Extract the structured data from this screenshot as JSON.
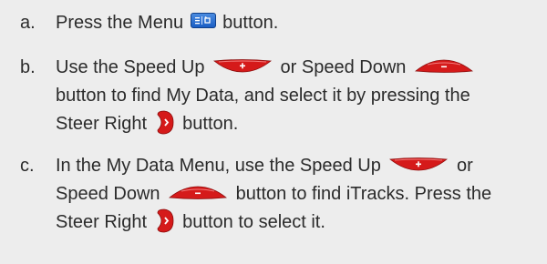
{
  "steps": [
    {
      "letter": "a.",
      "lines": [
        {
          "p1": "Press the Menu ",
          "p2": " button."
        }
      ]
    },
    {
      "letter": "b.",
      "lines": [
        {
          "p1": "Use the Speed Up ",
          "p2": " or Speed Down "
        },
        {
          "p1": "button to find My Data, and select it by pressing the"
        },
        {
          "p1": "Steer Right ",
          "p2": " button."
        }
      ]
    },
    {
      "letter": "c.",
      "lines": [
        {
          "p1": "In the My Data Menu, use the Speed Up ",
          "p2": " or"
        },
        {
          "p1": "Speed Down ",
          "p2": " button to find iTracks. Press the"
        },
        {
          "p1": "Steer Right ",
          "p2": " button to select it."
        }
      ]
    }
  ],
  "icons": {
    "menu": "menu-button-icon",
    "speed_up": "speed-up-button-icon",
    "speed_down": "speed-down-button-icon",
    "steer_right": "steer-right-button-icon"
  },
  "colors": {
    "text": "#2b2b2b",
    "background": "#ededed",
    "menu_blue": "#1b5ec4",
    "button_red": "#d51a1a"
  }
}
